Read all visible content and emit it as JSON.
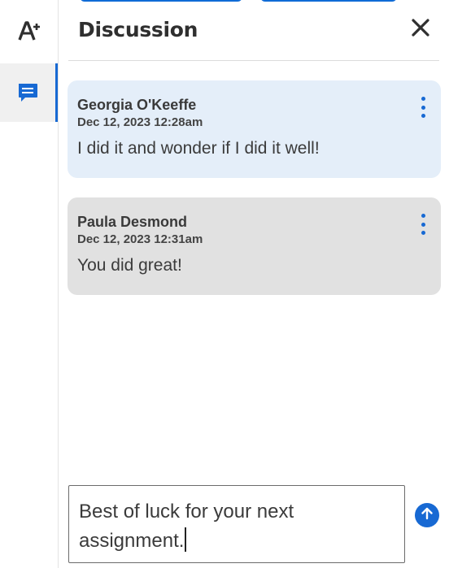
{
  "header": {
    "title": "Discussion"
  },
  "icons": {
    "rail_top": "a-plus-icon",
    "rail_chat": "chat-icon",
    "close": "close-icon",
    "menu": "kebab-menu-icon",
    "send": "arrow-up-icon"
  },
  "messages": [
    {
      "author": "Georgia O'Keeffe",
      "time": "Dec 12, 2023 12:28am",
      "text": "I did it and wonder if I did it well!"
    },
    {
      "author": "Paula Desmond",
      "time": "Dec 12, 2023 12:31am",
      "text": "You did great!"
    }
  ],
  "compose": {
    "value": "Best of luck for your next assignment."
  },
  "colors": {
    "accent": "#1769d3",
    "own_bubble": "#e4eef9",
    "other_bubble": "#e1e1e1"
  }
}
